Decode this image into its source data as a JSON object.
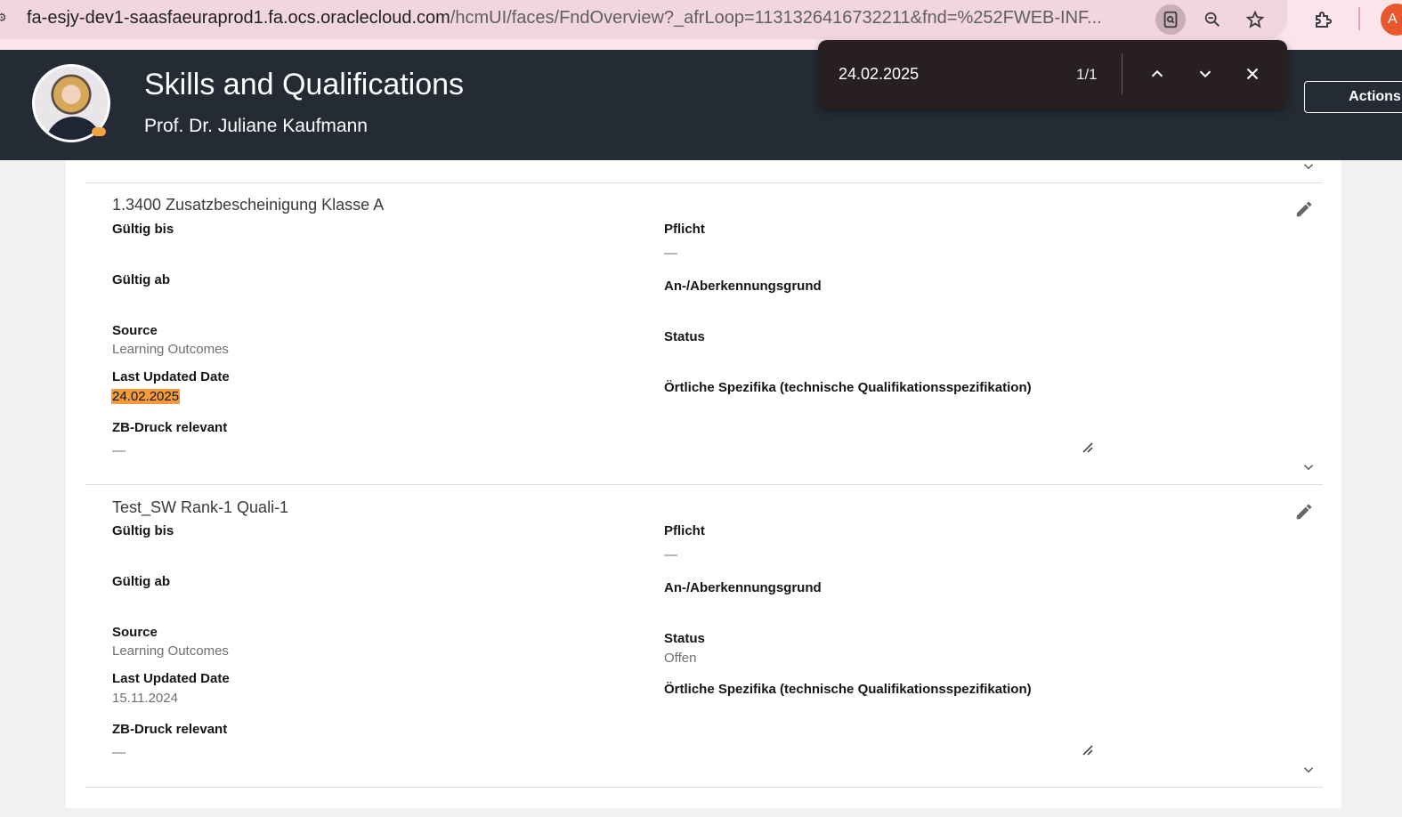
{
  "browser": {
    "url_host": "fa-esjy-dev1-saasfaeuraprod1.fa.ocs.oraclecloud.com",
    "url_path": "/hcmUI/faces/FndOverview?_afrLoop=1131326416732211&fnd=%252FWEB-INF...",
    "profile_initial": "A"
  },
  "find": {
    "query": "24.02.2025",
    "count": "1/1"
  },
  "header": {
    "title": "Skills and Qualifications",
    "person_name": "Prof. Dr. Juliane Kaufmann",
    "actions_label": "Actions"
  },
  "cards": [
    {
      "title": "1.3400 Zusatzbescheinigung Klasse A",
      "labels": {
        "gueltig_bis": "Gültig bis",
        "gueltig_ab": "Gültig ab",
        "source": "Source",
        "last_updated": "Last Updated Date",
        "zb_druck": "ZB-Druck relevant",
        "pflicht": "Pflicht",
        "grund": "An-/Aberkennungsgrund",
        "status": "Status",
        "spezifika": "Örtliche Spezifika (technische Qualifikationsspezifikation)"
      },
      "values": {
        "source": "Learning Outcomes",
        "last_updated": "24.02.2025",
        "zb_druck": "—",
        "pflicht": "—",
        "status": ""
      }
    },
    {
      "title": "Test_SW Rank-1 Quali-1",
      "labels": {
        "gueltig_bis": "Gültig bis",
        "gueltig_ab": "Gültig ab",
        "source": "Source",
        "last_updated": "Last Updated Date",
        "zb_druck": "ZB-Druck relevant",
        "pflicht": "Pflicht",
        "grund": "An-/Aberkennungsgrund",
        "status": "Status",
        "spezifika": "Örtliche Spezifika (technische Qualifikationsspezifikation)"
      },
      "values": {
        "source": "Learning Outcomes",
        "last_updated": "15.11.2024",
        "zb_druck": "—",
        "pflicht": "—",
        "status": "Offen"
      }
    }
  ],
  "colors": {
    "header_bg": "#242b35",
    "find_highlight": "#f59a3a",
    "browser_bar": "#fbe4ea"
  }
}
